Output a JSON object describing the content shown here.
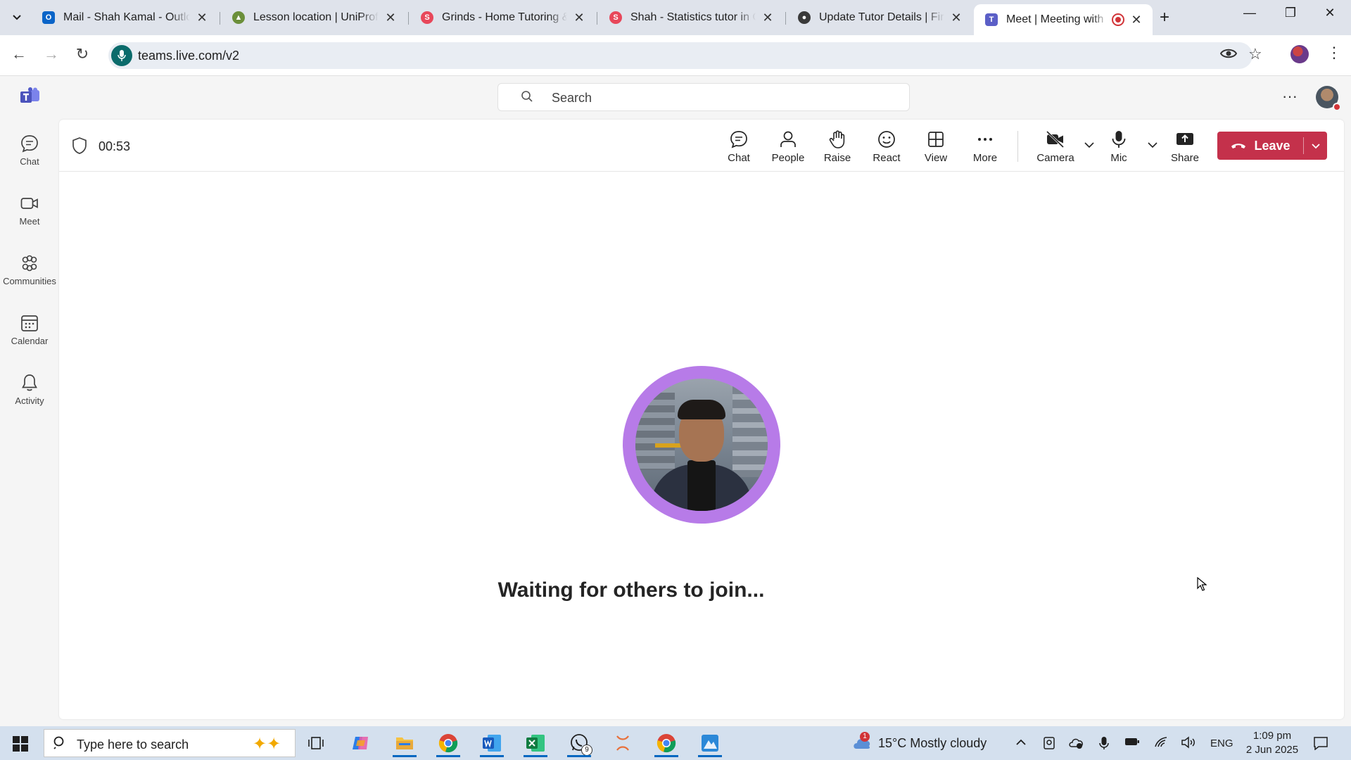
{
  "browser": {
    "tabs": [
      {
        "title": "Mail - Shah Kamal - Outlook",
        "favicon": "outlook-icon",
        "color": "#0a64c8"
      },
      {
        "title": "Lesson location | UniProf",
        "favicon": "uniprof-icon",
        "color": "#6b8f3a"
      },
      {
        "title": "Grinds - Home Tutoring & ",
        "favicon": "superprof-icon",
        "color": "#e8475a"
      },
      {
        "title": "Shah - Statistics tutor in Co",
        "favicon": "superprof-icon",
        "color": "#e8475a"
      },
      {
        "title": "Update Tutor Details | First",
        "favicon": "firsttutors-icon",
        "color": "#3a3a3a"
      },
      {
        "title": "Meet | Meeting with Sh",
        "favicon": "teams-icon",
        "color": "#5b5fc7",
        "active": true
      }
    ],
    "url": "teams.live.com/v2"
  },
  "teams": {
    "search_placeholder": "Search",
    "rail": [
      {
        "label": "Chat",
        "icon": "chat-icon"
      },
      {
        "label": "Meet",
        "icon": "video-icon"
      },
      {
        "label": "Communities",
        "icon": "communities-icon"
      },
      {
        "label": "Calendar",
        "icon": "calendar-icon"
      },
      {
        "label": "Activity",
        "icon": "bell-icon"
      }
    ],
    "meeting": {
      "timer": "00:53",
      "controls": {
        "chat": "Chat",
        "people": "People",
        "raise": "Raise",
        "react": "React",
        "view": "View",
        "more": "More",
        "camera": "Camera",
        "mic": "Mic",
        "share": "Share",
        "leave": "Leave"
      },
      "status_message": "Waiting for others to join..."
    },
    "colors": {
      "accent": "#5b5fc7",
      "leave": "#c4314b",
      "avatar_ring": "#b77be8"
    }
  },
  "taskbar": {
    "search_placeholder": "Type here to search",
    "whatsapp_badge": "9",
    "weather_badge": "1",
    "weather": "15°C  Mostly cloudy",
    "language": "ENG",
    "time": "1:09 pm",
    "date": "2 Jun 2025"
  }
}
